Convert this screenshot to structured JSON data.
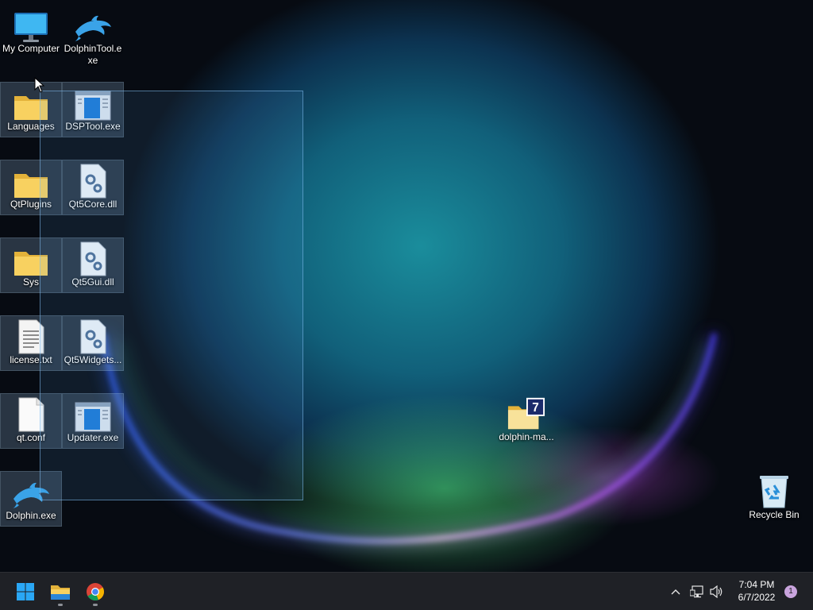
{
  "desktop": {
    "icons": [
      {
        "name": "My Computer",
        "type": "monitor"
      },
      {
        "name": "DolphinTool.exe",
        "type": "dolphin"
      },
      {
        "name": "Languages",
        "type": "folder"
      },
      {
        "name": "DSPTool.exe",
        "type": "app-window"
      },
      {
        "name": "QtPlugins",
        "type": "folder"
      },
      {
        "name": "Qt5Core.dll",
        "type": "dll"
      },
      {
        "name": "Sys",
        "type": "folder"
      },
      {
        "name": "Qt5Gui.dll",
        "type": "dll"
      },
      {
        "name": "license.txt",
        "type": "text-file"
      },
      {
        "name": "Qt5Widgets...",
        "type": "dll"
      },
      {
        "name": "qt.conf",
        "type": "blank-file"
      },
      {
        "name": "Updater.exe",
        "type": "app-window"
      },
      {
        "name": "Dolphin.exe",
        "type": "dolphin"
      },
      {
        "name": "dolphin-ma...",
        "type": "7z-archive"
      },
      {
        "name": "Recycle Bin",
        "type": "recycle-bin"
      }
    ]
  },
  "taskbar": {
    "pinned": [
      {
        "name": "Start",
        "icon": "windows-start-icon"
      },
      {
        "name": "File Explorer",
        "icon": "file-explorer-icon"
      },
      {
        "name": "Google Chrome",
        "icon": "chrome-icon"
      }
    ],
    "tray": {
      "overflow_icon": "chevron-up-icon",
      "network_icon": "network-icon",
      "volume_icon": "speaker-icon"
    },
    "clock": {
      "time": "7:04 PM",
      "date": "6/7/2022"
    },
    "notification_count": "1"
  },
  "colors": {
    "folder": "#f5cd5a",
    "accent_blue": "#1a8fe0",
    "taskbar": "#1f2126",
    "selection": "#8cbde0"
  }
}
